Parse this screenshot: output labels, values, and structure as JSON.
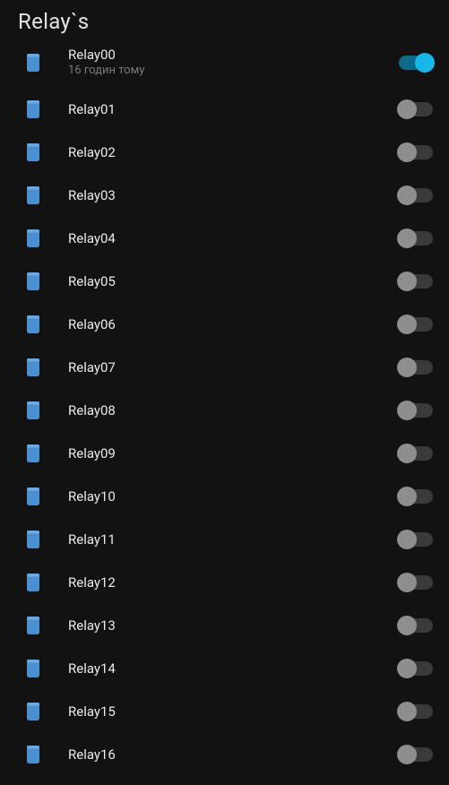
{
  "section_title": "Relay`s",
  "colors": {
    "bg": "#121212",
    "text": "#e8e8e8",
    "sub_text": "#7a7a7a",
    "icon": "#4a8fcf",
    "toggle_off_track": "#3a3a3a",
    "toggle_off_thumb": "#8e8e8e",
    "toggle_on_track": "#0e6a8a",
    "toggle_on_thumb": "#19b6ea"
  },
  "relays": [
    {
      "name": "Relay00",
      "subtitle": "16 годин тому",
      "on": true
    },
    {
      "name": "Relay01",
      "subtitle": "",
      "on": false
    },
    {
      "name": "Relay02",
      "subtitle": "",
      "on": false
    },
    {
      "name": "Relay03",
      "subtitle": "",
      "on": false
    },
    {
      "name": "Relay04",
      "subtitle": "",
      "on": false
    },
    {
      "name": "Relay05",
      "subtitle": "",
      "on": false
    },
    {
      "name": "Relay06",
      "subtitle": "",
      "on": false
    },
    {
      "name": "Relay07",
      "subtitle": "",
      "on": false
    },
    {
      "name": "Relay08",
      "subtitle": "",
      "on": false
    },
    {
      "name": "Relay09",
      "subtitle": "",
      "on": false
    },
    {
      "name": "Relay10",
      "subtitle": "",
      "on": false
    },
    {
      "name": "Relay11",
      "subtitle": "",
      "on": false
    },
    {
      "name": "Relay12",
      "subtitle": "",
      "on": false
    },
    {
      "name": "Relay13",
      "subtitle": "",
      "on": false
    },
    {
      "name": "Relay14",
      "subtitle": "",
      "on": false
    },
    {
      "name": "Relay15",
      "subtitle": "",
      "on": false
    },
    {
      "name": "Relay16",
      "subtitle": "",
      "on": false
    }
  ]
}
